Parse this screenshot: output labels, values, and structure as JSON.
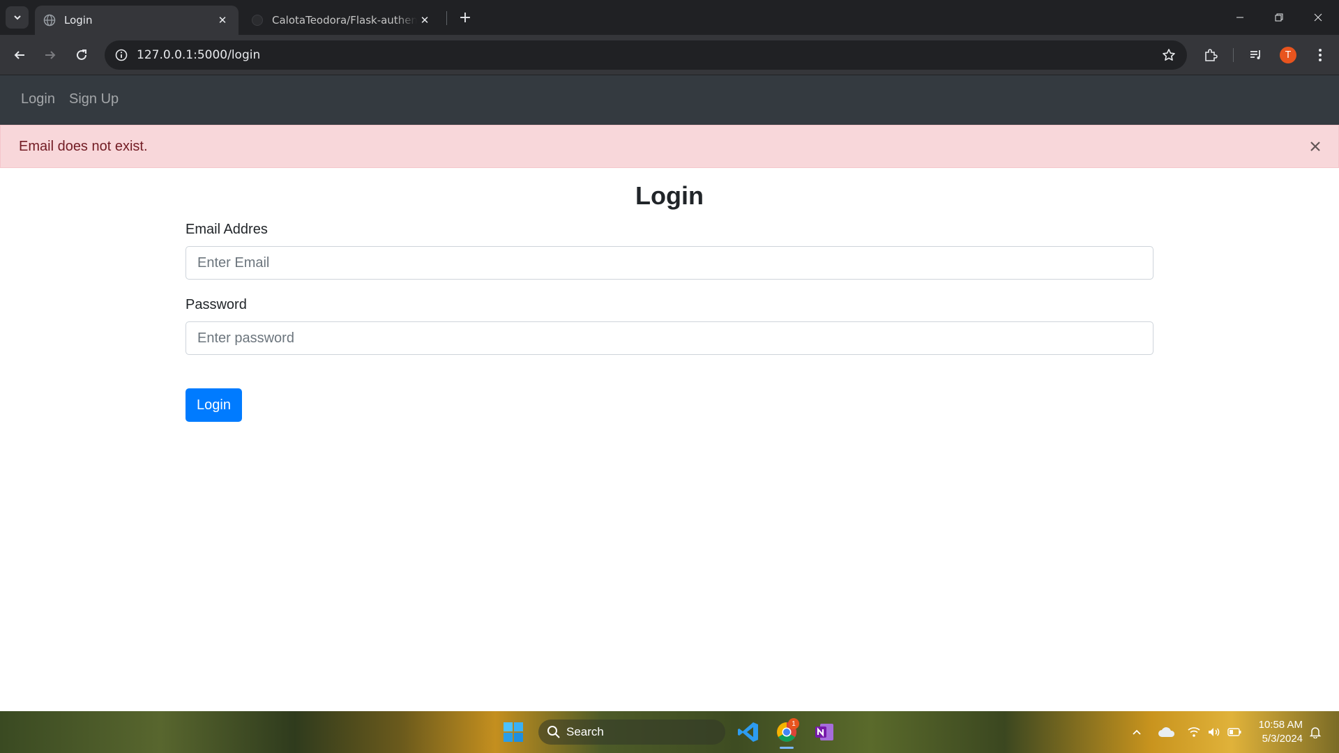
{
  "browser": {
    "tabs": [
      {
        "title": "Login",
        "active": true
      },
      {
        "title": "CalotaTeodora/Flask-authentication",
        "active": false
      }
    ],
    "url": "127.0.0.1:5000/login",
    "profile_initial": "T"
  },
  "navbar": {
    "links": [
      "Login",
      "Sign Up"
    ]
  },
  "alert": {
    "message": "Email does not exist.",
    "close_glyph": "×"
  },
  "form": {
    "title": "Login",
    "email_label": "Email Addres",
    "email_placeholder": "Enter Email",
    "password_label": "Password",
    "password_placeholder": "Enter password",
    "submit_label": "Login"
  },
  "taskbar": {
    "search_label": "Search",
    "chrome_badge": "1",
    "time": "10:58 AM",
    "date": "5/3/2024"
  },
  "colors": {
    "navbar_bg": "#343a40",
    "alert_bg": "#f8d7da",
    "alert_text": "#721c24",
    "primary": "#007bff"
  }
}
